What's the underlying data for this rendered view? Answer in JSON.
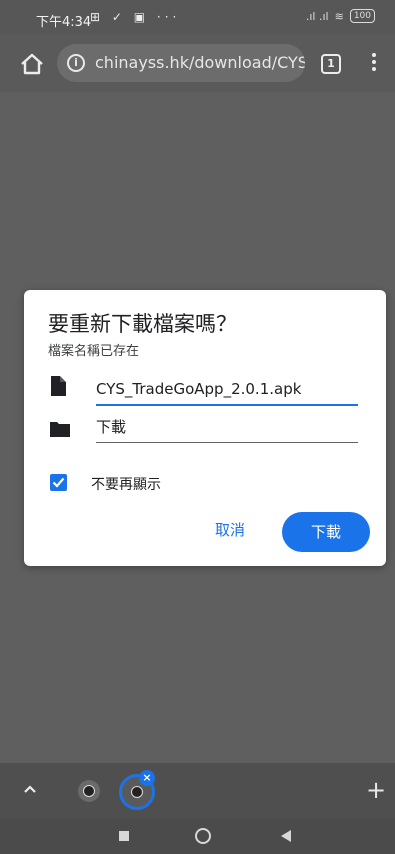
{
  "status_bar": {
    "time": "下午4:34",
    "left_icons": "⊞ ✓ ▣ ···",
    "signal": ".ıl .ıl",
    "wifi": "≋",
    "battery": "100"
  },
  "browser": {
    "url": "chinayss.hk/download/CYS_",
    "tab_count": "1"
  },
  "dialog": {
    "title": "要重新下載檔案嗎？",
    "subtitle": "檔案名稱已存在",
    "file_name": "CYS_TradeGoApp_2.0.1.apk",
    "folder": "下載",
    "checkbox_label": "不要再顯示",
    "checkbox_checked": true,
    "cancel_label": "取消",
    "download_label": "下載"
  },
  "bottom_bar": {
    "new_tab_label": "+"
  },
  "colors": {
    "accent": "#1a73e8",
    "scrim": "#5f5f5f"
  },
  "icons": [
    "home-icon",
    "info-icon",
    "tab-switcher-icon",
    "more-menu-icon",
    "file-icon",
    "folder-icon",
    "check-icon",
    "chevron-up-icon",
    "globe-icon",
    "close-icon",
    "plus-icon",
    "recents-icon",
    "nav-home-icon",
    "back-icon"
  ]
}
